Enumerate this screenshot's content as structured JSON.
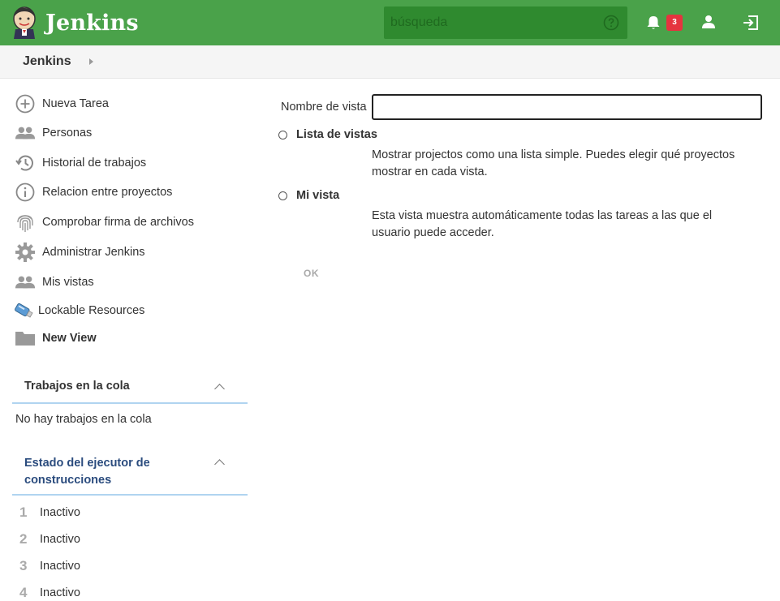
{
  "header": {
    "title": "Jenkins",
    "search_placeholder": "búsqueda",
    "notifications_count": "3",
    "icons": [
      "jenkins-logo",
      "help-icon",
      "bell-icon",
      "user-icon",
      "logout-icon"
    ]
  },
  "breadcrumb": {
    "items": [
      "Jenkins"
    ]
  },
  "sidebar": {
    "items": [
      {
        "label": "Nueva Tarea",
        "icon": "plus-circle-icon"
      },
      {
        "label": "Personas",
        "icon": "people-icon"
      },
      {
        "label": "Historial de trabajos",
        "icon": "history-icon"
      },
      {
        "label": "Relacion entre proyectos",
        "icon": "info-icon"
      },
      {
        "label": "Comprobar firma de archivos",
        "icon": "fingerprint-icon"
      },
      {
        "label": "Administrar Jenkins",
        "icon": "gear-icon"
      },
      {
        "label": "Mis vistas",
        "icon": "people-icon"
      },
      {
        "label": "Lockable Resources",
        "icon": "usb-icon"
      },
      {
        "label": "New View",
        "icon": "folder-icon"
      }
    ]
  },
  "queue": {
    "title": "Trabajos en la cola",
    "empty_text": "No hay trabajos en la cola"
  },
  "executors": {
    "title_line1": "Estado del ejecutor de",
    "title_line2": "construcciones",
    "rows": [
      {
        "num": "1",
        "label": "Inactivo"
      },
      {
        "num": "2",
        "label": "Inactivo"
      },
      {
        "num": "3",
        "label": "Inactivo"
      },
      {
        "num": "4",
        "label": "Inactivo"
      }
    ]
  },
  "form": {
    "name_label": "Nombre de vista",
    "name_value": "",
    "options": [
      {
        "label": "Lista de vistas",
        "desc": "Mostrar projectos como una lista simple. Puedes elegir qué proyectos mostrar en cada vista."
      },
      {
        "label": "Mi vista",
        "desc": "Esta vista muestra automáticamente todas las tareas a las que el usuario puede acceder."
      }
    ],
    "ok_label": "OK"
  },
  "colors": {
    "header_green": "#4aa24a",
    "search_green": "#2f8a2f",
    "badge_red": "#e5343f",
    "panel_border": "#b0d4f0",
    "executor_title": "#2b4c7e"
  }
}
